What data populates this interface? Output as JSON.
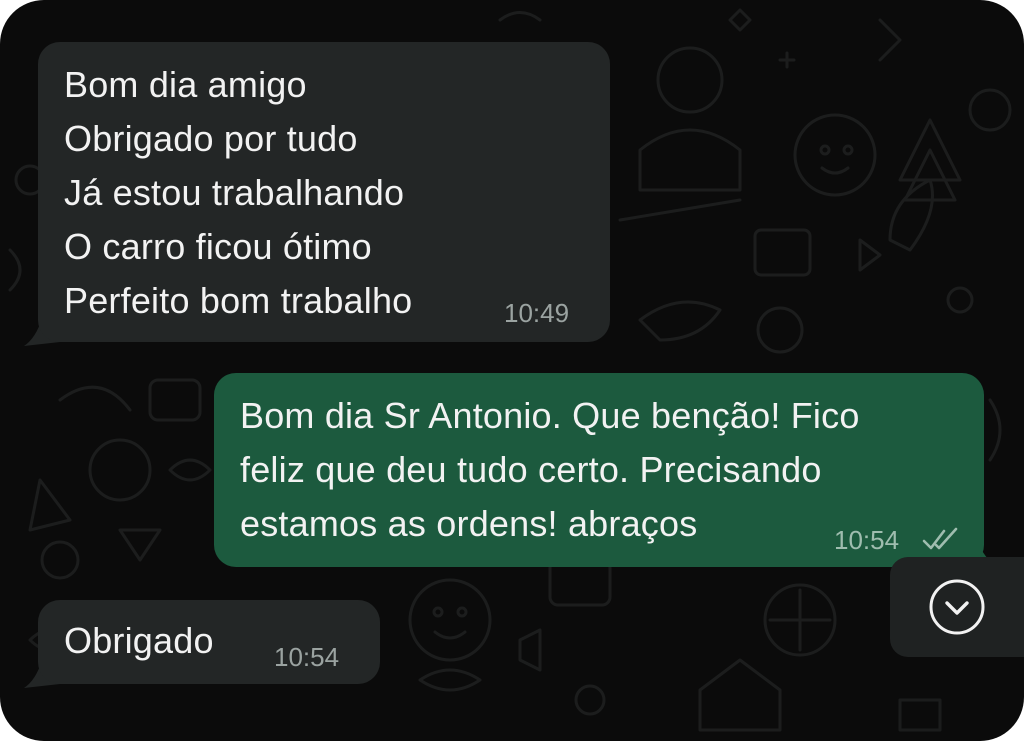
{
  "messages": [
    {
      "direction": "incoming",
      "lines": [
        "Bom dia amigo",
        "Obrigado por tudo",
        "Já estou trabalhando",
        "O carro ficou ótimo",
        "Perfeito bom trabalho"
      ],
      "time": "10:49"
    },
    {
      "direction": "outgoing",
      "lines": [
        "Bom dia Sr Antonio. Que benção! Fico",
        "feliz que deu tudo certo. Precisando",
        "estamos as ordens! abraços"
      ],
      "time": "10:54",
      "status_icon": "double-check-read-icon"
    },
    {
      "direction": "incoming",
      "lines": [
        "Obrigado"
      ],
      "time": "10:54"
    }
  ],
  "scroll_button": {
    "icon": "chevron-down-circle-icon"
  },
  "colors": {
    "background": "#0b0b0b",
    "incoming_bubble": "#232626",
    "outgoing_bubble": "#1c5a3e",
    "text": "#f2f2f2",
    "timestamp": "#9ba3a1"
  }
}
